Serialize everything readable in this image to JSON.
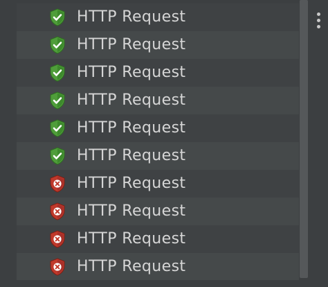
{
  "results_tree": {
    "items": [
      {
        "label": "HTTP Request",
        "status": "success",
        "icon": "shield-check-icon"
      },
      {
        "label": "HTTP Request",
        "status": "success",
        "icon": "shield-check-icon"
      },
      {
        "label": "HTTP Request",
        "status": "success",
        "icon": "shield-check-icon"
      },
      {
        "label": "HTTP Request",
        "status": "success",
        "icon": "shield-check-icon"
      },
      {
        "label": "HTTP Request",
        "status": "success",
        "icon": "shield-check-icon"
      },
      {
        "label": "HTTP Request",
        "status": "success",
        "icon": "shield-check-icon"
      },
      {
        "label": "HTTP Request",
        "status": "failure",
        "icon": "shield-error-icon"
      },
      {
        "label": "HTTP Request",
        "status": "failure",
        "icon": "shield-error-icon"
      },
      {
        "label": "HTTP Request",
        "status": "failure",
        "icon": "shield-error-icon"
      },
      {
        "label": "HTTP Request",
        "status": "failure",
        "icon": "shield-error-icon"
      }
    ]
  },
  "colors": {
    "success_shield": "#4f9d3a",
    "failure_shield": "#c0392b",
    "text": "#d6d6d6",
    "background": "#3c3f41"
  },
  "more_menu_icon": "vertical-ellipsis-icon"
}
